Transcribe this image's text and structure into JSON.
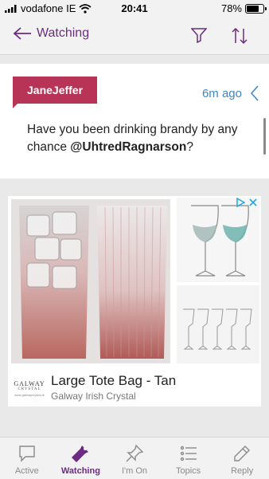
{
  "status_bar": {
    "carrier": "vodafone IE",
    "time": "20:41",
    "battery": "78%"
  },
  "nav": {
    "back_label": "Watching",
    "accent_color": "#6b2c82"
  },
  "post": {
    "author": "JaneJeffer",
    "time_ago": "6m ago",
    "message_text": "Have you been drinking brandy by any chance ",
    "mention": "@UhtredRagnarson",
    "message_end": "?"
  },
  "ad": {
    "title": "Large Tote Bag - Tan",
    "advertiser": "Galway Irish Crystal",
    "logo_line1": "GALWAY",
    "logo_line2": "CRYSTAL",
    "logo_line3": "www.galwaycrystal.ie"
  },
  "tabs": [
    {
      "label": "Active",
      "icon": "speech-bubble-icon",
      "active": false
    },
    {
      "label": "Watching",
      "icon": "flashlight-icon",
      "active": true
    },
    {
      "label": "I'm On",
      "icon": "pin-icon",
      "active": false
    },
    {
      "label": "Topics",
      "icon": "list-icon",
      "active": false
    },
    {
      "label": "Reply",
      "icon": "pencil-icon",
      "active": false
    }
  ]
}
